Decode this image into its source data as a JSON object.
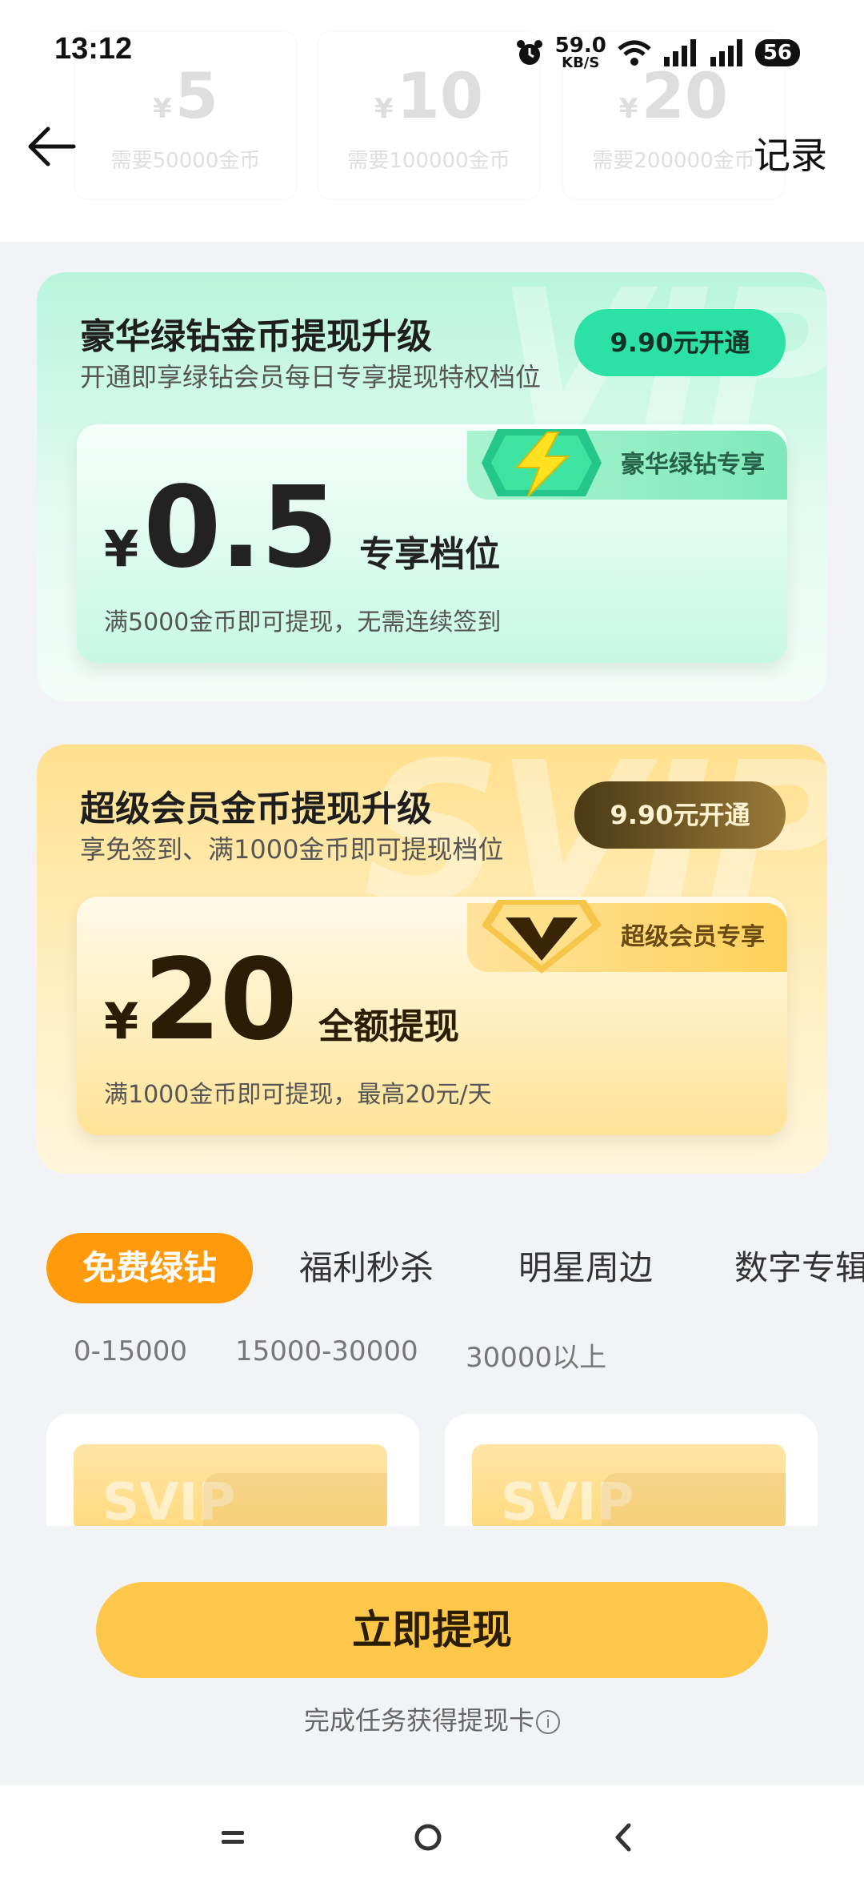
{
  "status_bar": {
    "time": "13:12",
    "net_speed_value": "59.0",
    "net_speed_unit": "KB/S",
    "battery": "56",
    "icons": [
      "alarm-icon",
      "wifi-icon",
      "signal-icon",
      "signal-icon",
      "battery-icon"
    ]
  },
  "header": {
    "record_label": "记录"
  },
  "tiers": [
    {
      "currency": "¥",
      "amount": "5",
      "requirement": "需要50000金币"
    },
    {
      "currency": "¥",
      "amount": "10",
      "requirement": "需要100000金币"
    },
    {
      "currency": "¥",
      "amount": "20",
      "requirement": "需要200000金币"
    }
  ],
  "green_card": {
    "watermark": "VIP",
    "title": "豪华绿钻金币提现升级",
    "subtitle": "开通即享绿钻会员每日专享提现特权档位",
    "button": "9.90元开通",
    "ribbon": "豪华绿钻专享",
    "currency": "¥",
    "amount": "0.5",
    "tag": "专享档位",
    "note": "满5000金币即可提现，无需连续签到"
  },
  "gold_card": {
    "watermark": "SVIP",
    "title": "超级会员金币提现升级",
    "subtitle": "享免签到、满1000金币即可提现档位",
    "button": "9.90元开通",
    "ribbon": "超级会员专享",
    "currency": "¥",
    "amount": "20",
    "tag": "全额提现",
    "note": "满1000金币即可提现，最高20元/天"
  },
  "tabs": [
    "免费绿钻",
    "福利秒杀",
    "明星周边",
    "数字专辑"
  ],
  "active_tab": "免费绿钻",
  "ranges": [
    "0-15000",
    "15000-30000",
    "30000以上"
  ],
  "products": [
    {
      "watermark": "SVIP"
    },
    {
      "watermark": "SVIP"
    }
  ],
  "footer": {
    "withdraw_button": "立即提现",
    "hint": "完成任务获得提现卡",
    "info_symbol": "i"
  },
  "colors": {
    "accent_orange": "#ff9a0c",
    "green_button": "#2be1a6",
    "gold_button": "#fdc84a",
    "page_bg": "#f1f3f7"
  }
}
